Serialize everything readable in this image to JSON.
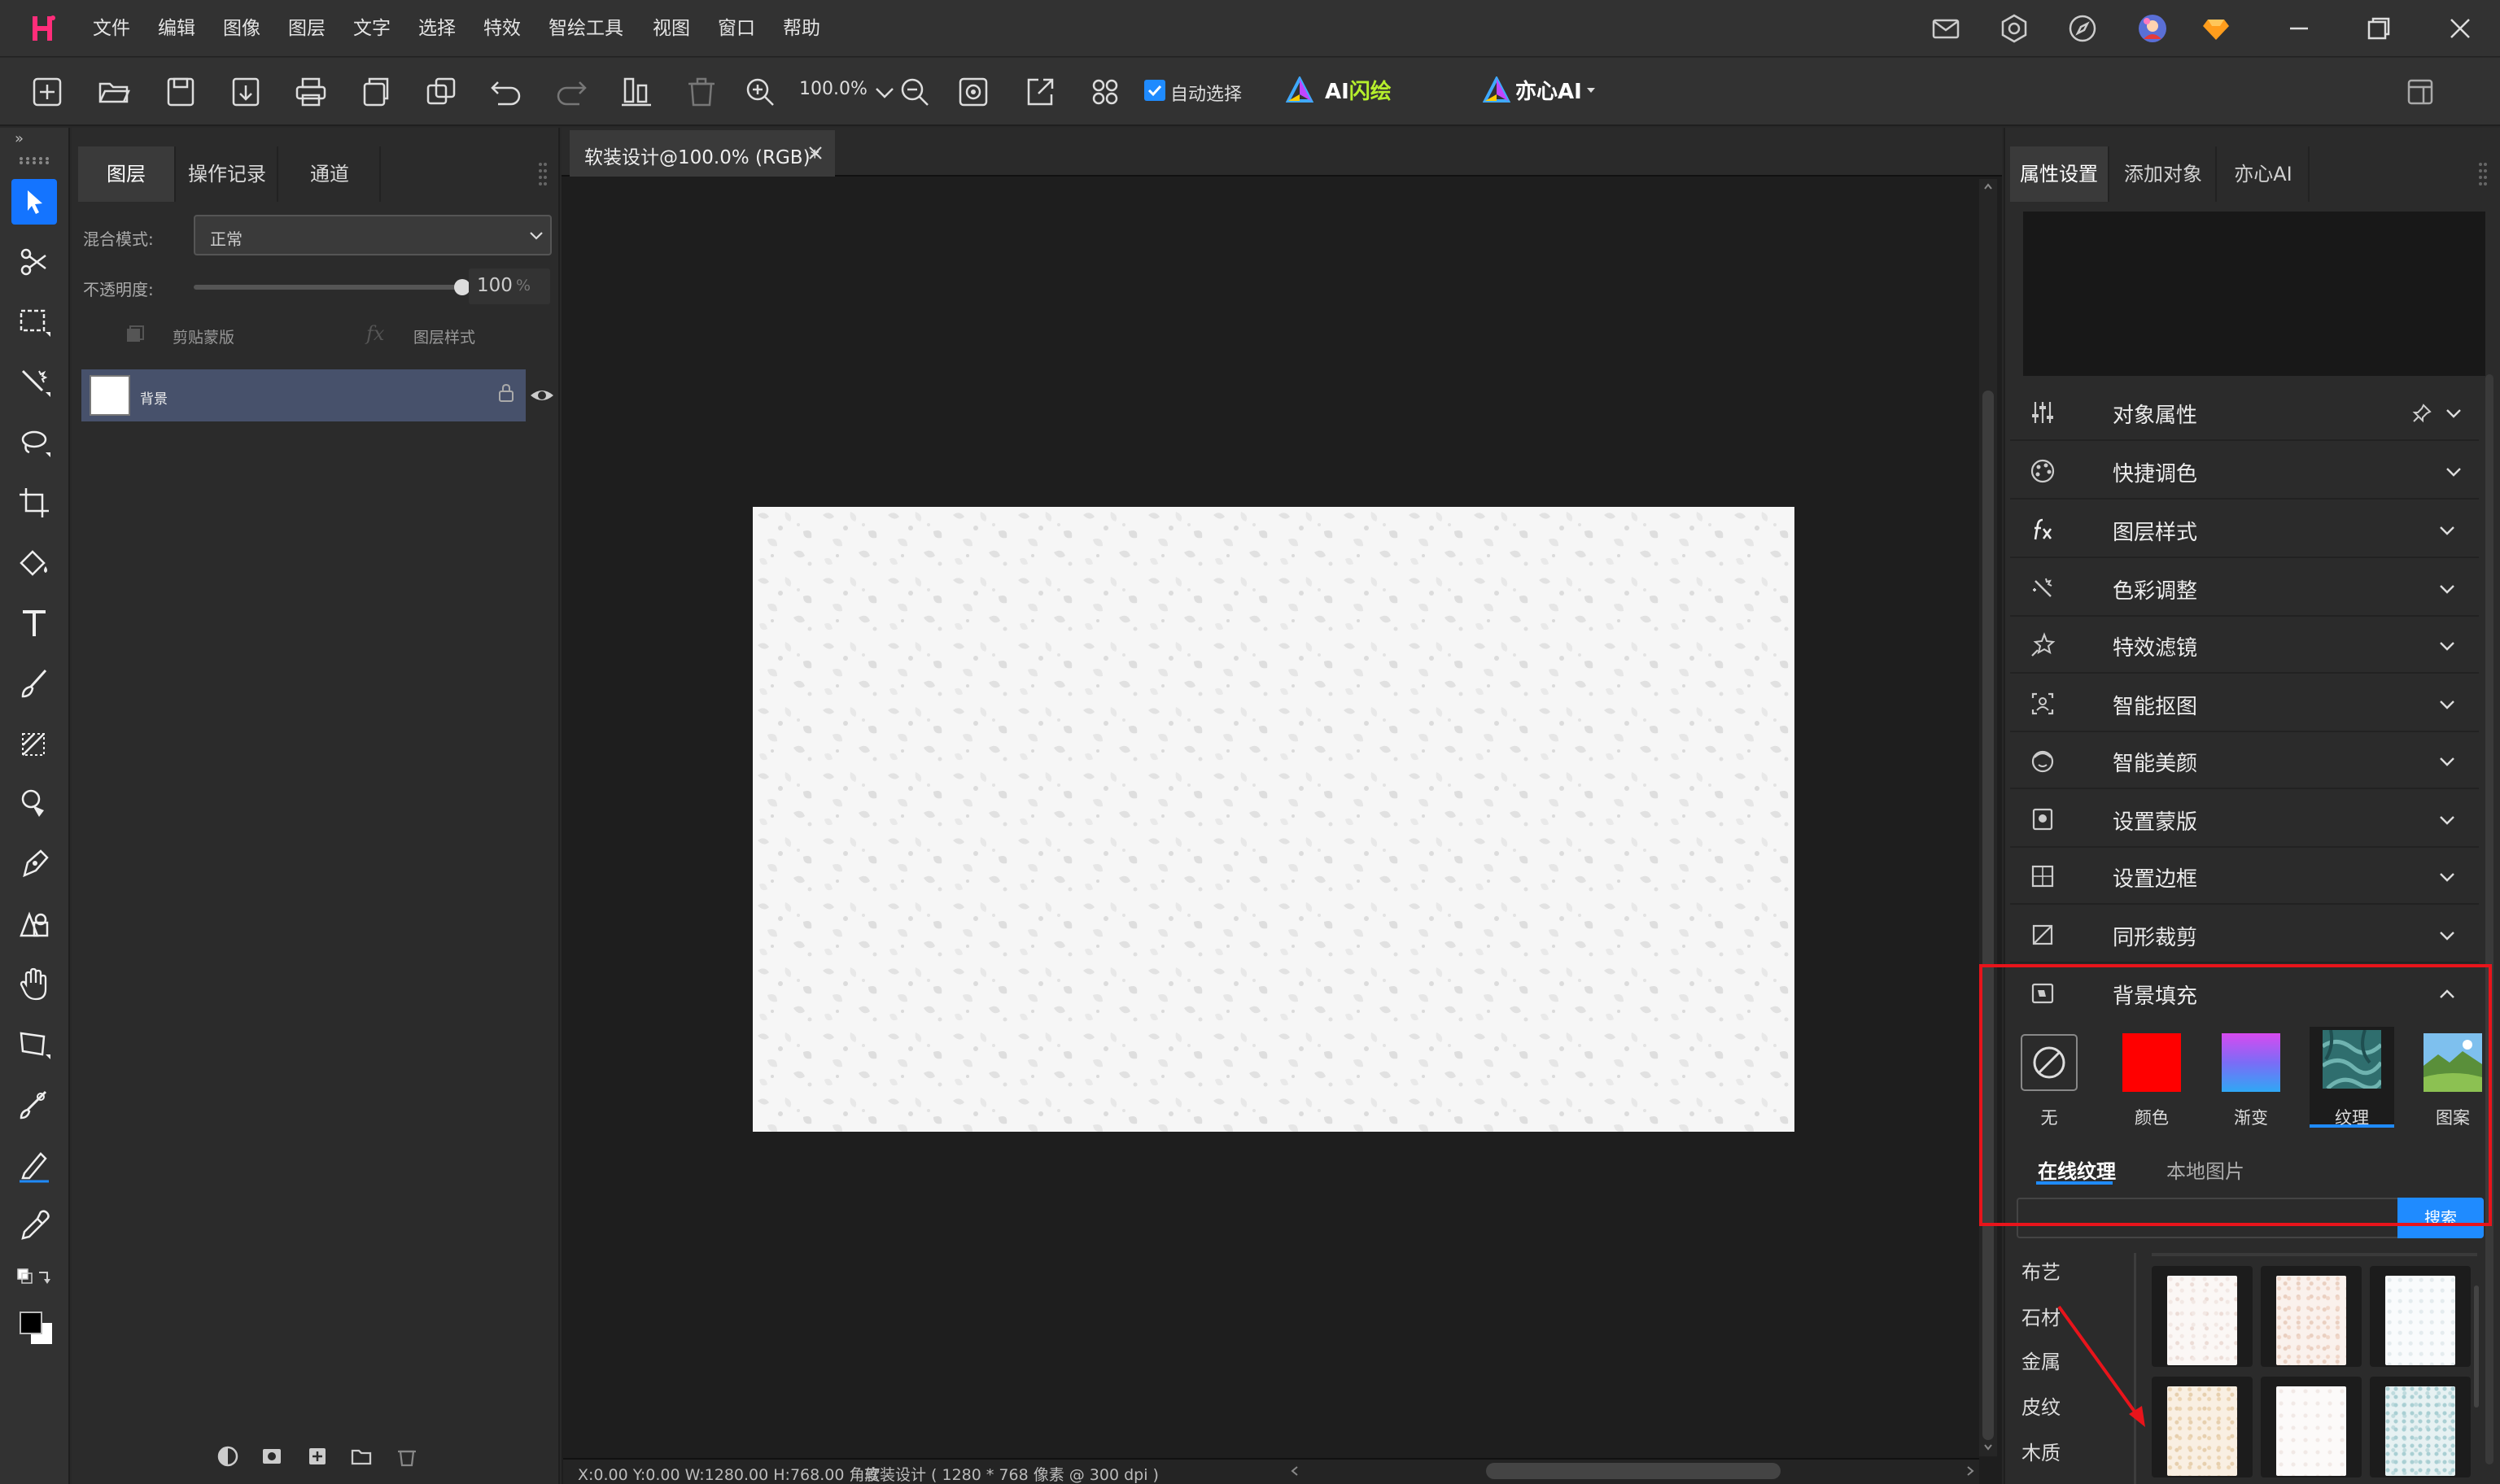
{
  "app": {
    "logo_letter": "H",
    "menus": [
      "文件",
      "编辑",
      "图像",
      "图层",
      "文字",
      "选择",
      "特效",
      "智绘工具",
      "视图",
      "窗口",
      "帮助"
    ]
  },
  "toolbar": {
    "zoom_value": "100.0%",
    "auto_select_label": "自动选择",
    "ai_flash_prefix": "AI",
    "ai_flash_suffix": "闪绘",
    "yixin_ai_label": "亦心AI"
  },
  "layers_panel": {
    "tabs": [
      "图层",
      "操作记录",
      "通道"
    ],
    "blend_mode_label": "混合模式:",
    "blend_mode_value": "正常",
    "opacity_label": "不透明度:",
    "opacity_value": "100",
    "opacity_unit": "%",
    "opacity_level": 1.0,
    "clip_mask_label": "剪贴蒙版",
    "fx_glyph": "fx",
    "layer_style_label": "图层样式",
    "layer_name": "背景"
  },
  "document": {
    "tab_title": "软装设计@100.0% (RGB)*",
    "status_text": "X:0.00 Y:0.00 W:1280.00 H:768.00 角度",
    "status_doc_info": "软装设计 ( 1280 * 768 像素 @ 300 dpi )"
  },
  "right_panel": {
    "tabs": [
      "属性设置",
      "添加对象",
      "亦心AI"
    ],
    "properties": [
      {
        "label": "对象属性",
        "icon": "sliders-icon"
      },
      {
        "label": "快捷调色",
        "icon": "palette-icon"
      },
      {
        "label": "图层样式",
        "icon": "fx-icon"
      },
      {
        "label": "色彩调整",
        "icon": "magic-wand-icon"
      },
      {
        "label": "特效滤镜",
        "icon": "sparkle-icon"
      },
      {
        "label": "智能抠图",
        "icon": "cutout-icon"
      },
      {
        "label": "智能美颜",
        "icon": "face-icon"
      },
      {
        "label": "设置蒙版",
        "icon": "mask-icon"
      },
      {
        "label": "设置边框",
        "icon": "border-icon"
      },
      {
        "label": "同形裁剪",
        "icon": "crop-shape-icon"
      },
      {
        "label": "背景填充",
        "icon": "fill-icon"
      }
    ],
    "fill_options": [
      {
        "label": "无",
        "color": ""
      },
      {
        "label": "颜色",
        "color": "#ff0000"
      },
      {
        "label": "渐变",
        "color": ""
      },
      {
        "label": "纹理",
        "color": ""
      },
      {
        "label": "图案",
        "color": ""
      }
    ],
    "selected_fill": "纹理",
    "texture_tabs": [
      "在线纹理",
      "本地图片"
    ],
    "search_button": "搜索",
    "categories": [
      "布艺",
      "石材",
      "金属",
      "皮纹",
      "木质"
    ]
  },
  "colors": {
    "accent": "#1f8bff",
    "highlight_box": "#e8141b",
    "layer_selected": "#47516b"
  }
}
